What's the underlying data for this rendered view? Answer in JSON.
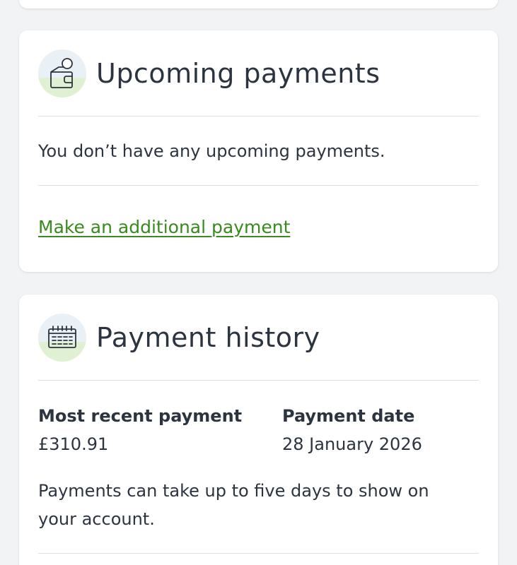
{
  "upcoming": {
    "title": "Upcoming payments",
    "icon": "wallet-icon",
    "message": "You don’t have any upcoming payments.",
    "link_label": "Make an additional payment"
  },
  "history": {
    "title": "Payment history",
    "icon": "calendar-icon",
    "recent_label": "Most recent payment",
    "recent_value": "£310.91",
    "date_label": "Payment date",
    "date_value": "28 January 2026",
    "note": "Payments can take up to five days to show on your account."
  },
  "colors": {
    "link": "#3a8a1f",
    "text": "#2c3440",
    "icon_bg_blue": "#e9f1f7",
    "icon_bg_green": "#dff0d3"
  }
}
